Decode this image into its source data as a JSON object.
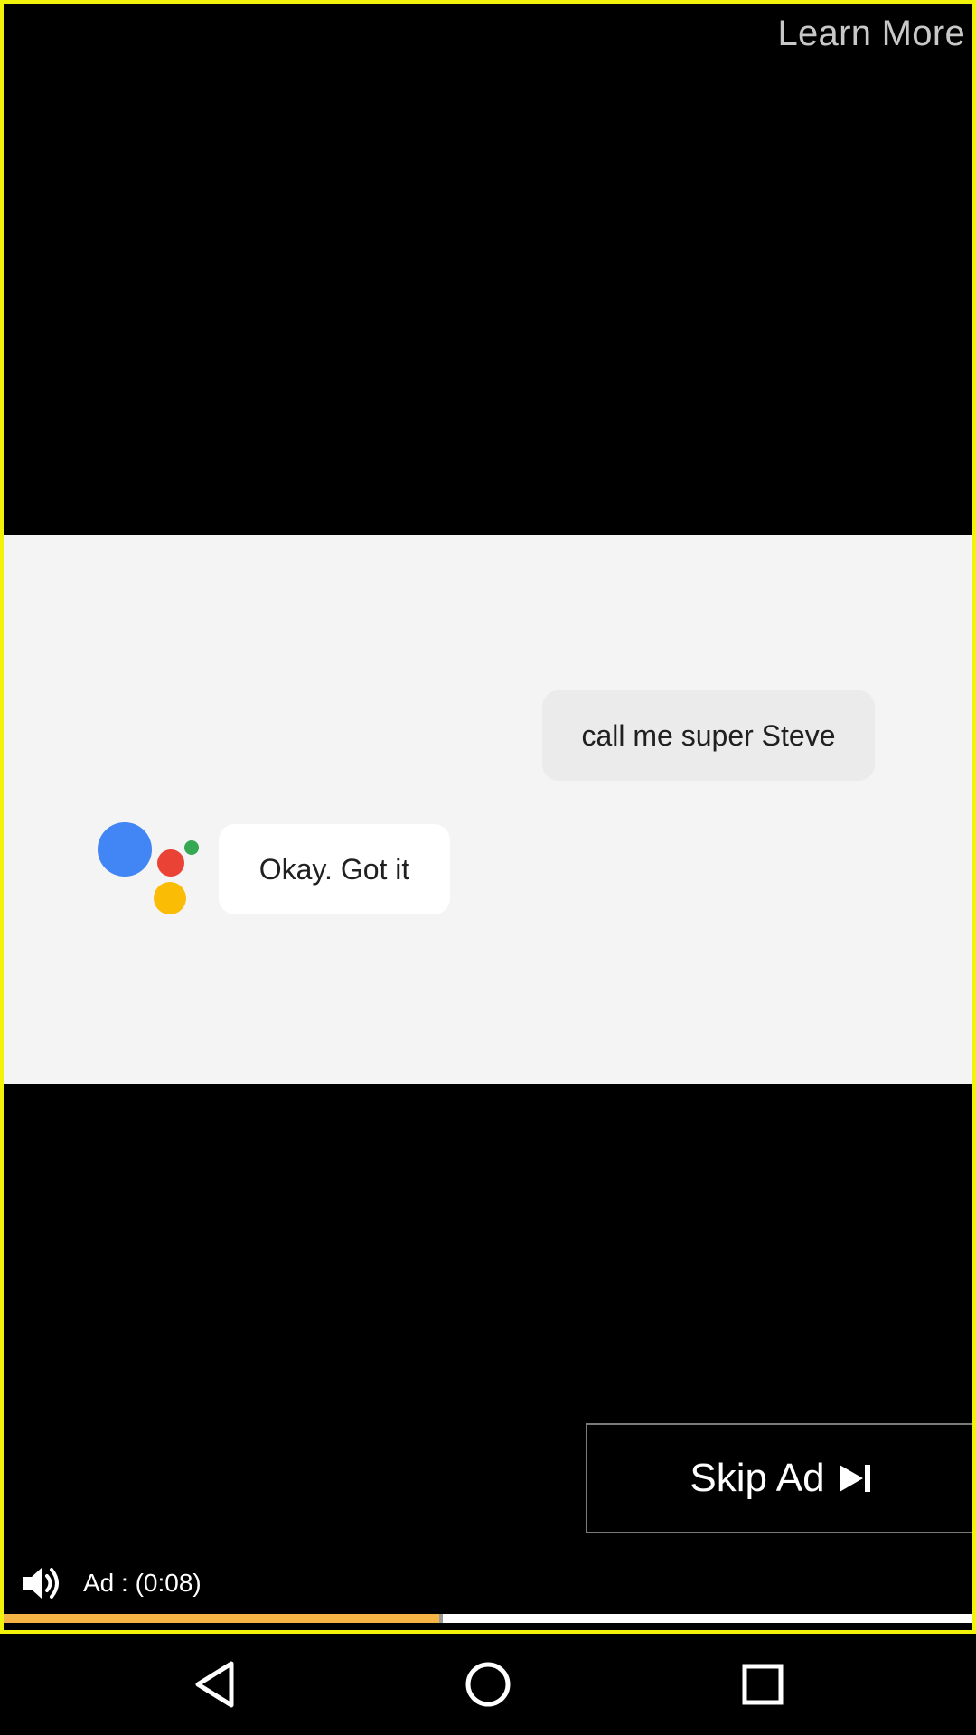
{
  "player": {
    "learn_more_label": "Learn More",
    "frame_color": "#f2f20a",
    "skip_ad_label": "Skip Ad",
    "ad_timer": "Ad : (0:08)",
    "progress": 0.45
  },
  "video": {
    "user_message": "call me super Steve",
    "assistant_message": "Okay. Got it",
    "logo_colors": {
      "blue": "#4285f4",
      "red": "#ea4335",
      "green": "#34a853",
      "yellow": "#fbbc05"
    }
  },
  "icons": {
    "volume": "speaker-icon",
    "skip": "skip-next-icon",
    "back": "back-triangle-icon",
    "home": "home-circle-icon",
    "recents": "recents-square-icon"
  }
}
